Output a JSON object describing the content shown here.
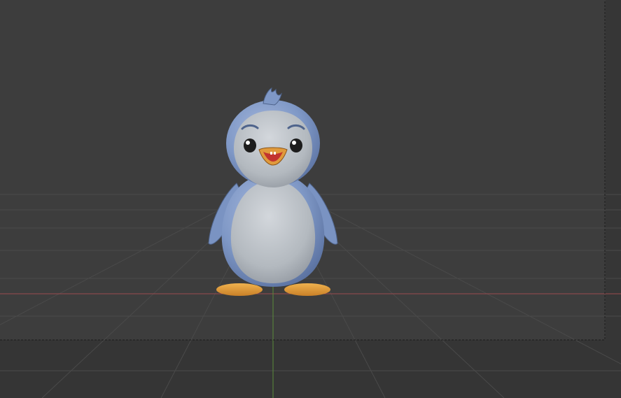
{
  "viewport": {
    "background_color": "#3d3d3d",
    "outside_frame_color": "#353535",
    "grid_color": "#4a4a4a",
    "x_axis_color": "#9a4a4f",
    "y_axis_color": "#5b8a3a",
    "frame_border_color": "#1a1a1a"
  },
  "model": {
    "body_color": "#7f98c6",
    "belly_color": "#b9bec4",
    "beak_color": "#e09a3c",
    "feet_color": "#e7a23f",
    "eye_color": "#1c1c1c"
  }
}
